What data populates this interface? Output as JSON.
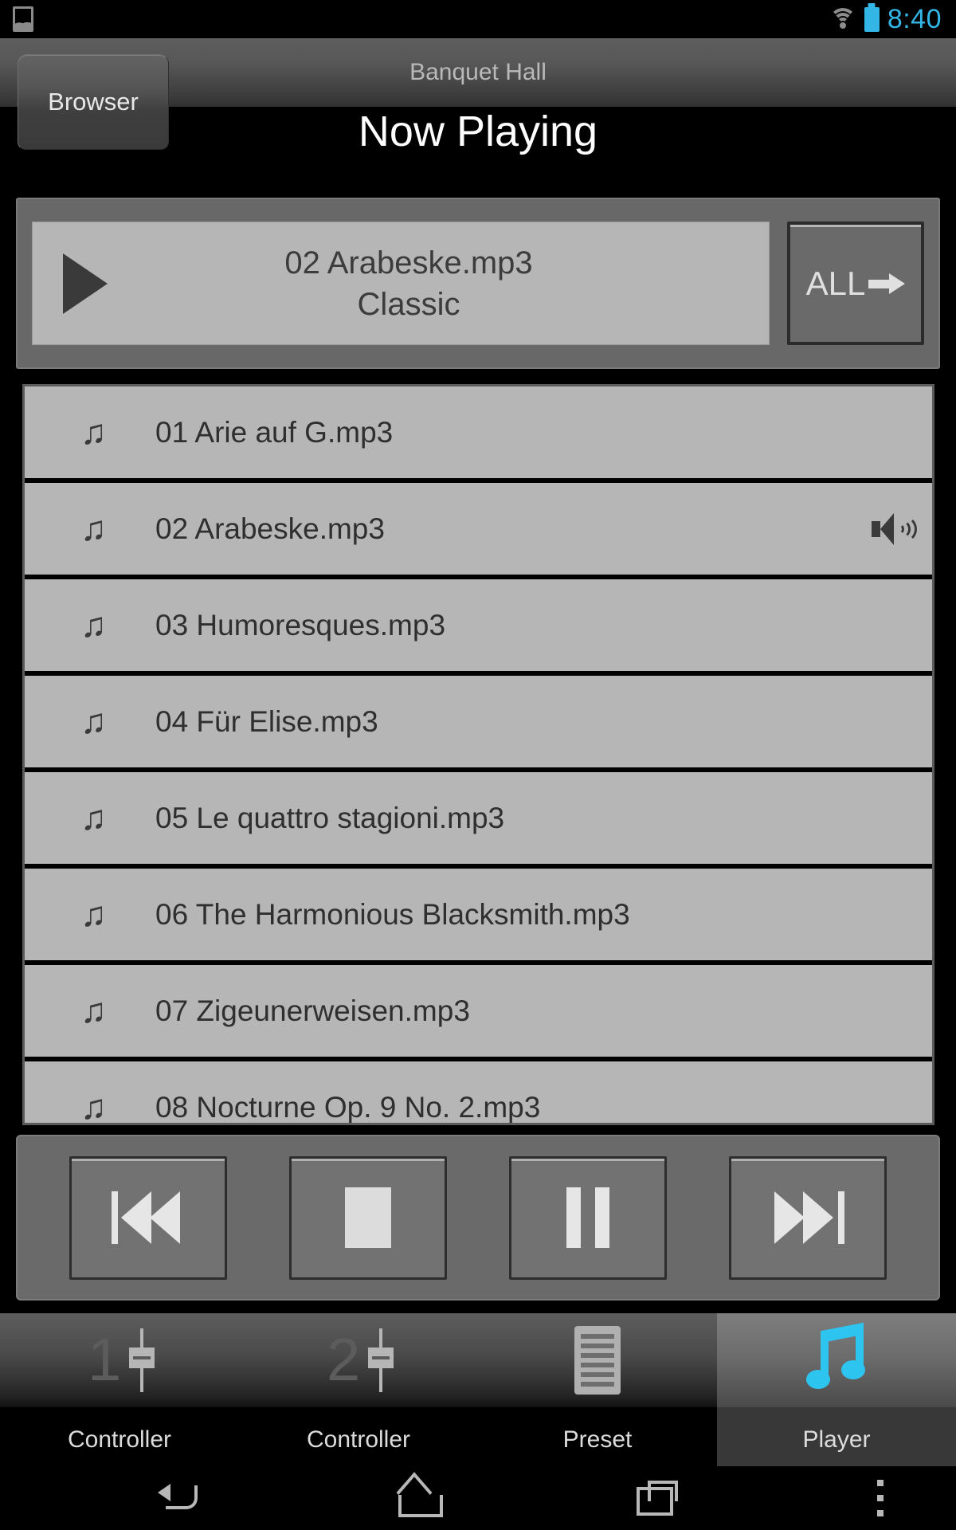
{
  "status_bar": {
    "notification_icon": "gallery-icon",
    "wifi_icon": "wifi-icon",
    "battery_icon": "battery-icon",
    "time": "8:40",
    "accent_color": "#33b5e5"
  },
  "header": {
    "browser_button": "Browser",
    "subtitle": "Banquet Hall",
    "title": "Now Playing"
  },
  "now_playing": {
    "play_icon": "play-icon",
    "track_title": "02 Arabeske.mp3",
    "album": "Classic",
    "all_button": "ALL",
    "all_button_icon": "arrow-right-icon"
  },
  "playlist": {
    "items": [
      {
        "icon": "music-note-icon",
        "name": "01 Arie auf G.mp3",
        "playing": false
      },
      {
        "icon": "music-note-icon",
        "name": "02 Arabeske.mp3",
        "playing": true,
        "playing_icon": "speaker-icon"
      },
      {
        "icon": "music-note-icon",
        "name": "03 Humoresques.mp3",
        "playing": false
      },
      {
        "icon": "music-note-icon",
        "name": "04 Für Elise.mp3",
        "playing": false
      },
      {
        "icon": "music-note-icon",
        "name": "05 Le quattro stagioni.mp3",
        "playing": false
      },
      {
        "icon": "music-note-icon",
        "name": "06 The Harmonious Blacksmith.mp3",
        "playing": false
      },
      {
        "icon": "music-note-icon",
        "name": "07 Zigeunerweisen.mp3",
        "playing": false
      },
      {
        "icon": "music-note-icon",
        "name": "08 Nocturne Op. 9 No. 2.mp3",
        "playing": false
      }
    ]
  },
  "transport": {
    "buttons": [
      {
        "name": "previous",
        "icon": "skip-previous-icon"
      },
      {
        "name": "stop",
        "icon": "stop-icon"
      },
      {
        "name": "pause",
        "icon": "pause-icon"
      },
      {
        "name": "next",
        "icon": "skip-next-icon"
      }
    ]
  },
  "tabs": [
    {
      "label": "Controller",
      "icon": "fader-1-icon",
      "number": "1",
      "active": false
    },
    {
      "label": "Controller",
      "icon": "fader-2-icon",
      "number": "2",
      "active": false
    },
    {
      "label": "Preset",
      "icon": "preset-list-icon",
      "active": false
    },
    {
      "label": "Player",
      "icon": "music-note-icon",
      "active": true,
      "active_color": "#2ec4f0"
    }
  ],
  "nav_bar": {
    "back": "back-icon",
    "home": "home-icon",
    "recents": "recents-icon",
    "overflow": "overflow-menu-icon"
  }
}
